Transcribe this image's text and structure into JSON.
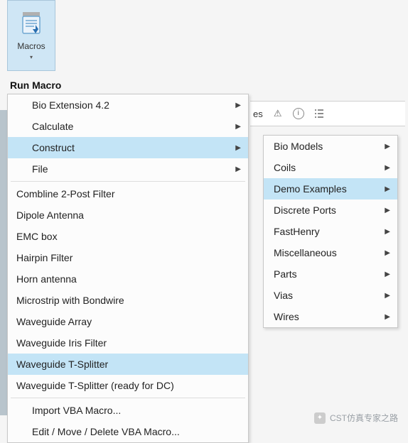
{
  "ribbon": {
    "macros_label": "Macros"
  },
  "title": "Run Macro",
  "toolbar": {
    "tab_suffix": "es",
    "warn_icon": "warning-icon",
    "info_icon": "info-icon",
    "list_icon": "outline-icon"
  },
  "menu": {
    "items": [
      {
        "label": "Bio Extension 4.2",
        "submenu": true,
        "hl": false,
        "indent": true
      },
      {
        "label": "Calculate",
        "submenu": true,
        "hl": false,
        "indent": true
      },
      {
        "label": "Construct",
        "submenu": true,
        "hl": true,
        "indent": true
      },
      {
        "label": "File",
        "submenu": true,
        "hl": false,
        "indent": true
      },
      {
        "sep": true
      },
      {
        "label": "Combline 2-Post Filter",
        "submenu": false,
        "hl": false,
        "indent": false
      },
      {
        "label": "Dipole Antenna",
        "submenu": false,
        "hl": false,
        "indent": false
      },
      {
        "label": "EMC box",
        "submenu": false,
        "hl": false,
        "indent": false
      },
      {
        "label": "Hairpin Filter",
        "submenu": false,
        "hl": false,
        "indent": false
      },
      {
        "label": "Horn antenna",
        "submenu": false,
        "hl": false,
        "indent": false
      },
      {
        "label": "Microstrip with Bondwire",
        "submenu": false,
        "hl": false,
        "indent": false
      },
      {
        "label": "Waveguide Array",
        "submenu": false,
        "hl": false,
        "indent": false
      },
      {
        "label": "Waveguide Iris Filter",
        "submenu": false,
        "hl": false,
        "indent": false
      },
      {
        "label": "Waveguide T-Splitter",
        "submenu": false,
        "hl": true,
        "indent": false
      },
      {
        "label": "Waveguide T-Splitter (ready for DC)",
        "submenu": false,
        "hl": false,
        "indent": false
      },
      {
        "sep": true
      },
      {
        "label": "Import VBA Macro...",
        "submenu": false,
        "hl": false,
        "indent": true
      },
      {
        "label": "Edit / Move / Delete VBA Macro...",
        "submenu": false,
        "hl": false,
        "indent": true
      }
    ]
  },
  "submenu": {
    "items": [
      {
        "label": "Bio Models",
        "hl": false
      },
      {
        "label": "Coils",
        "hl": false
      },
      {
        "label": "Demo Examples",
        "hl": true
      },
      {
        "label": "Discrete Ports",
        "hl": false
      },
      {
        "label": "FastHenry",
        "hl": false
      },
      {
        "label": "Miscellaneous",
        "hl": false
      },
      {
        "label": "Parts",
        "hl": false
      },
      {
        "label": "Vias",
        "hl": false
      },
      {
        "label": "Wires",
        "hl": false
      }
    ]
  },
  "watermark": {
    "text": "CST仿真专家之路"
  }
}
